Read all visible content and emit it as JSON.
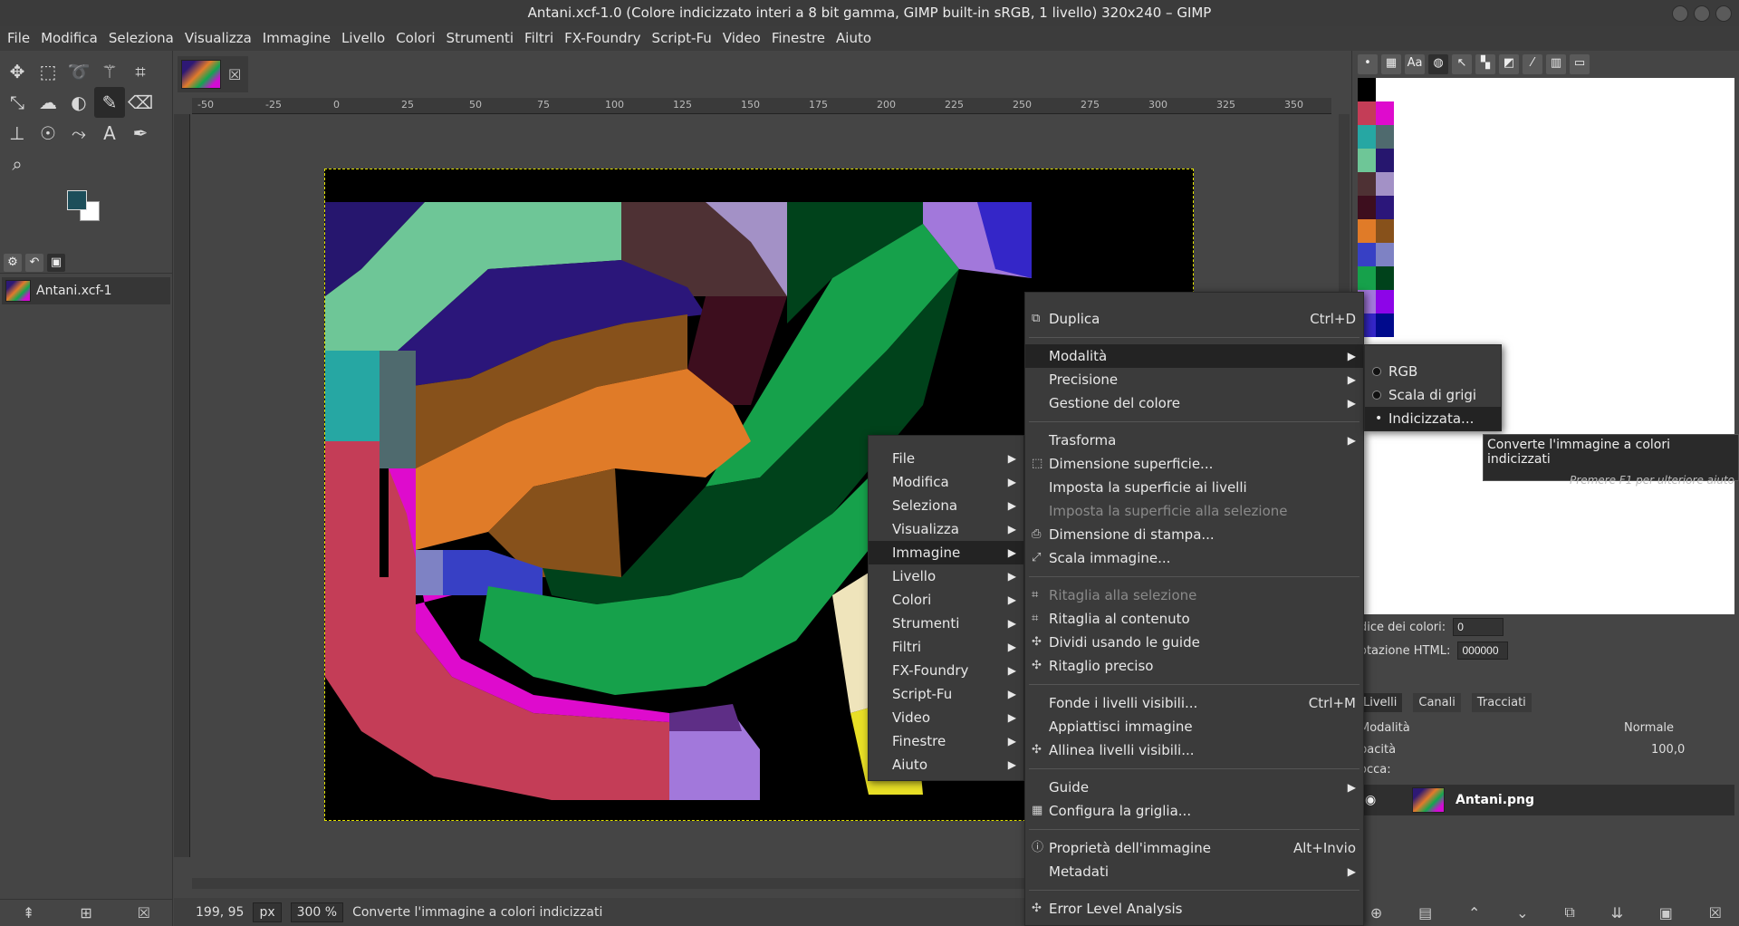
{
  "window": {
    "title": "Antani.xcf-1.0 (Colore indicizzato interi a 8 bit gamma, GIMP built-in sRGB, 1 livello) 320x240 – GIMP"
  },
  "menubar": [
    "File",
    "Modifica",
    "Seleziona",
    "Visualizza",
    "Immagine",
    "Livello",
    "Colori",
    "Strumenti",
    "Filtri",
    "FX-Foundry",
    "Script-Fu",
    "Video",
    "Finestre",
    "Aiuto"
  ],
  "toolbox": {
    "tools": [
      "move-icon",
      "rect-select-icon",
      "lasso-icon",
      "fuzzy-select-icon",
      "crop-icon",
      "transform-icon",
      "warp-icon",
      "bucket-fill-icon",
      "paintbrush-icon",
      "eraser-icon",
      "clone-icon",
      "smudge-icon",
      "paths-icon",
      "text-icon",
      "color-picker-icon",
      "zoom-icon"
    ],
    "fg_color": "#1d4e5a",
    "bg_color": "#ffffff",
    "image_name": "Antani.xcf-1"
  },
  "ruler": {
    "labels": [
      "-50",
      "-25",
      "0",
      "25",
      "50",
      "75",
      "100",
      "125",
      "150",
      "175",
      "200",
      "225",
      "250",
      "275",
      "300",
      "325",
      "350"
    ]
  },
  "status": {
    "coords": "199, 95",
    "unit": "px",
    "zoom": "300 %",
    "message": "Converte l'immagine a colori indicizzati"
  },
  "main_menu": {
    "items": [
      "File",
      "Modifica",
      "Seleziona",
      "Visualizza",
      "Immagine",
      "Livello",
      "Colori",
      "Strumenti",
      "Filtri",
      "FX-Foundry",
      "Script-Fu",
      "Video",
      "Finestre",
      "Aiuto"
    ],
    "highlighted": "Immagine"
  },
  "image_menu": {
    "duplica": "Duplica",
    "duplica_acc": "Ctrl+D",
    "modalita": "Modalità",
    "precisione": "Precisione",
    "gestione": "Gestione del colore",
    "trasforma": "Trasforma",
    "dim_sup": "Dimensione superficie...",
    "imposta_livelli": "Imposta la superficie ai livelli",
    "imposta_sel": "Imposta la superficie alla selezione",
    "dim_stampa": "Dimensione di stampa...",
    "scala": "Scala immagine...",
    "ritaglia_sel": "Ritaglia alla selezione",
    "ritaglia_cont": "Ritaglia al contenuto",
    "dividi": "Dividi usando le guide",
    "ritaglio_preciso": "Ritaglio preciso",
    "fonde": "Fonde i livelli visibili...",
    "fonde_acc": "Ctrl+M",
    "appiattisci": "Appiattisci immagine",
    "allinea": "Allinea livelli visibili...",
    "guide": "Guide",
    "griglia": "Configura la griglia...",
    "proprieta": "Proprietà dell'immagine",
    "proprieta_acc": "Alt+Invio",
    "metadati": "Metadati",
    "ela": "Error Level Analysis"
  },
  "mode_menu": {
    "rgb": "RGB",
    "grigi": "Scala di grigi",
    "indicizzata": "Indicizzata..."
  },
  "tooltip": {
    "text": "Converte l'immagine a colori indicizzati",
    "help": "Premere F1 per ulteriore aiuto"
  },
  "palette": {
    "colors": [
      "#000000",
      "#ffffff",
      "#c43d57",
      "#de0bcd",
      "#26a7a3",
      "#4f6a6e",
      "#6ec697",
      "#26166e",
      "#4e3134",
      "#a391c6",
      "#3d0e1e",
      "#2b167a",
      "#e07b28",
      "#87511b",
      "#3740c5",
      "#7e82c4",
      "#16a14b",
      "#00421b",
      "#a278db",
      "#8d05e8",
      "#3426c8",
      "#000a8c"
    ],
    "index_label": "dice dei colori:",
    "index_value": "0",
    "html_label": "otazione HTML:",
    "html_value": "000000"
  },
  "layers": {
    "tabs": [
      "Livelli",
      "Canali",
      "Tracciati"
    ],
    "mode_label": "Modalità",
    "mode_value": "Normale",
    "opacity_label": "pacità",
    "opacity_value": "100,0",
    "lock_label": "occa:",
    "layer_name": "Antani.png"
  }
}
